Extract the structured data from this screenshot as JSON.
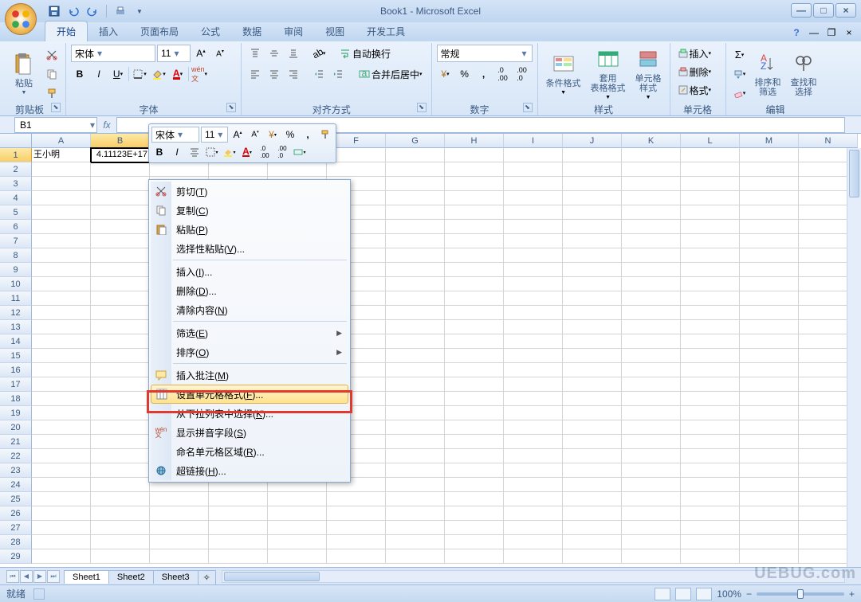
{
  "title": "Book1 - Microsoft Excel",
  "tabs": {
    "t0": "开始",
    "t1": "插入",
    "t2": "页面布局",
    "t3": "公式",
    "t4": "数据",
    "t5": "审阅",
    "t6": "视图",
    "t7": "开发工具"
  },
  "ribbon": {
    "clipboard": {
      "label": "剪贴板",
      "paste": "粘贴"
    },
    "font": {
      "label": "字体",
      "name": "宋体",
      "size": "11"
    },
    "align": {
      "label": "对齐方式",
      "wrap": "自动换行",
      "merge": "合并后居中"
    },
    "number": {
      "label": "数字",
      "fmt": "常规"
    },
    "styles": {
      "label": "样式",
      "cond": "条件格式",
      "tbl": "套用\n表格格式",
      "cell": "单元格\n样式"
    },
    "cells": {
      "label": "单元格",
      "ins": "插入",
      "del": "删除",
      "fmt": "格式"
    },
    "edit": {
      "label": "编辑",
      "sort": "排序和\n筛选",
      "find": "查找和\n选择"
    }
  },
  "mini": {
    "font": "宋体",
    "size": "11"
  },
  "namebox": "B1",
  "cells": {
    "A1": "王小明",
    "B1": "4.11123E+17"
  },
  "columns": [
    "A",
    "B",
    "C",
    "D",
    "E",
    "F",
    "G",
    "H",
    "I",
    "J",
    "K",
    "L",
    "M",
    "N"
  ],
  "rowcount": 29,
  "ctx": {
    "cut": "剪切(T)",
    "copy": "复制(C)",
    "paste": "粘贴(P)",
    "pspecial": "选择性粘贴(V)...",
    "insert": "插入(I)...",
    "delete": "删除(D)...",
    "clear": "清除内容(N)",
    "filter": "筛选(E)",
    "sort": "排序(O)",
    "comment": "插入批注(M)",
    "format": "设置单元格格式(F)...",
    "pick": "从下拉列表中选择(K)...",
    "pinyin": "显示拼音字段(S)",
    "name": "命名单元格区域(R)...",
    "link": "超链接(H)..."
  },
  "sheets": {
    "s1": "Sheet1",
    "s2": "Sheet2",
    "s3": "Sheet3"
  },
  "status": {
    "ready": "就绪",
    "zoom": "100%"
  },
  "watermark": "UEBUG.com"
}
